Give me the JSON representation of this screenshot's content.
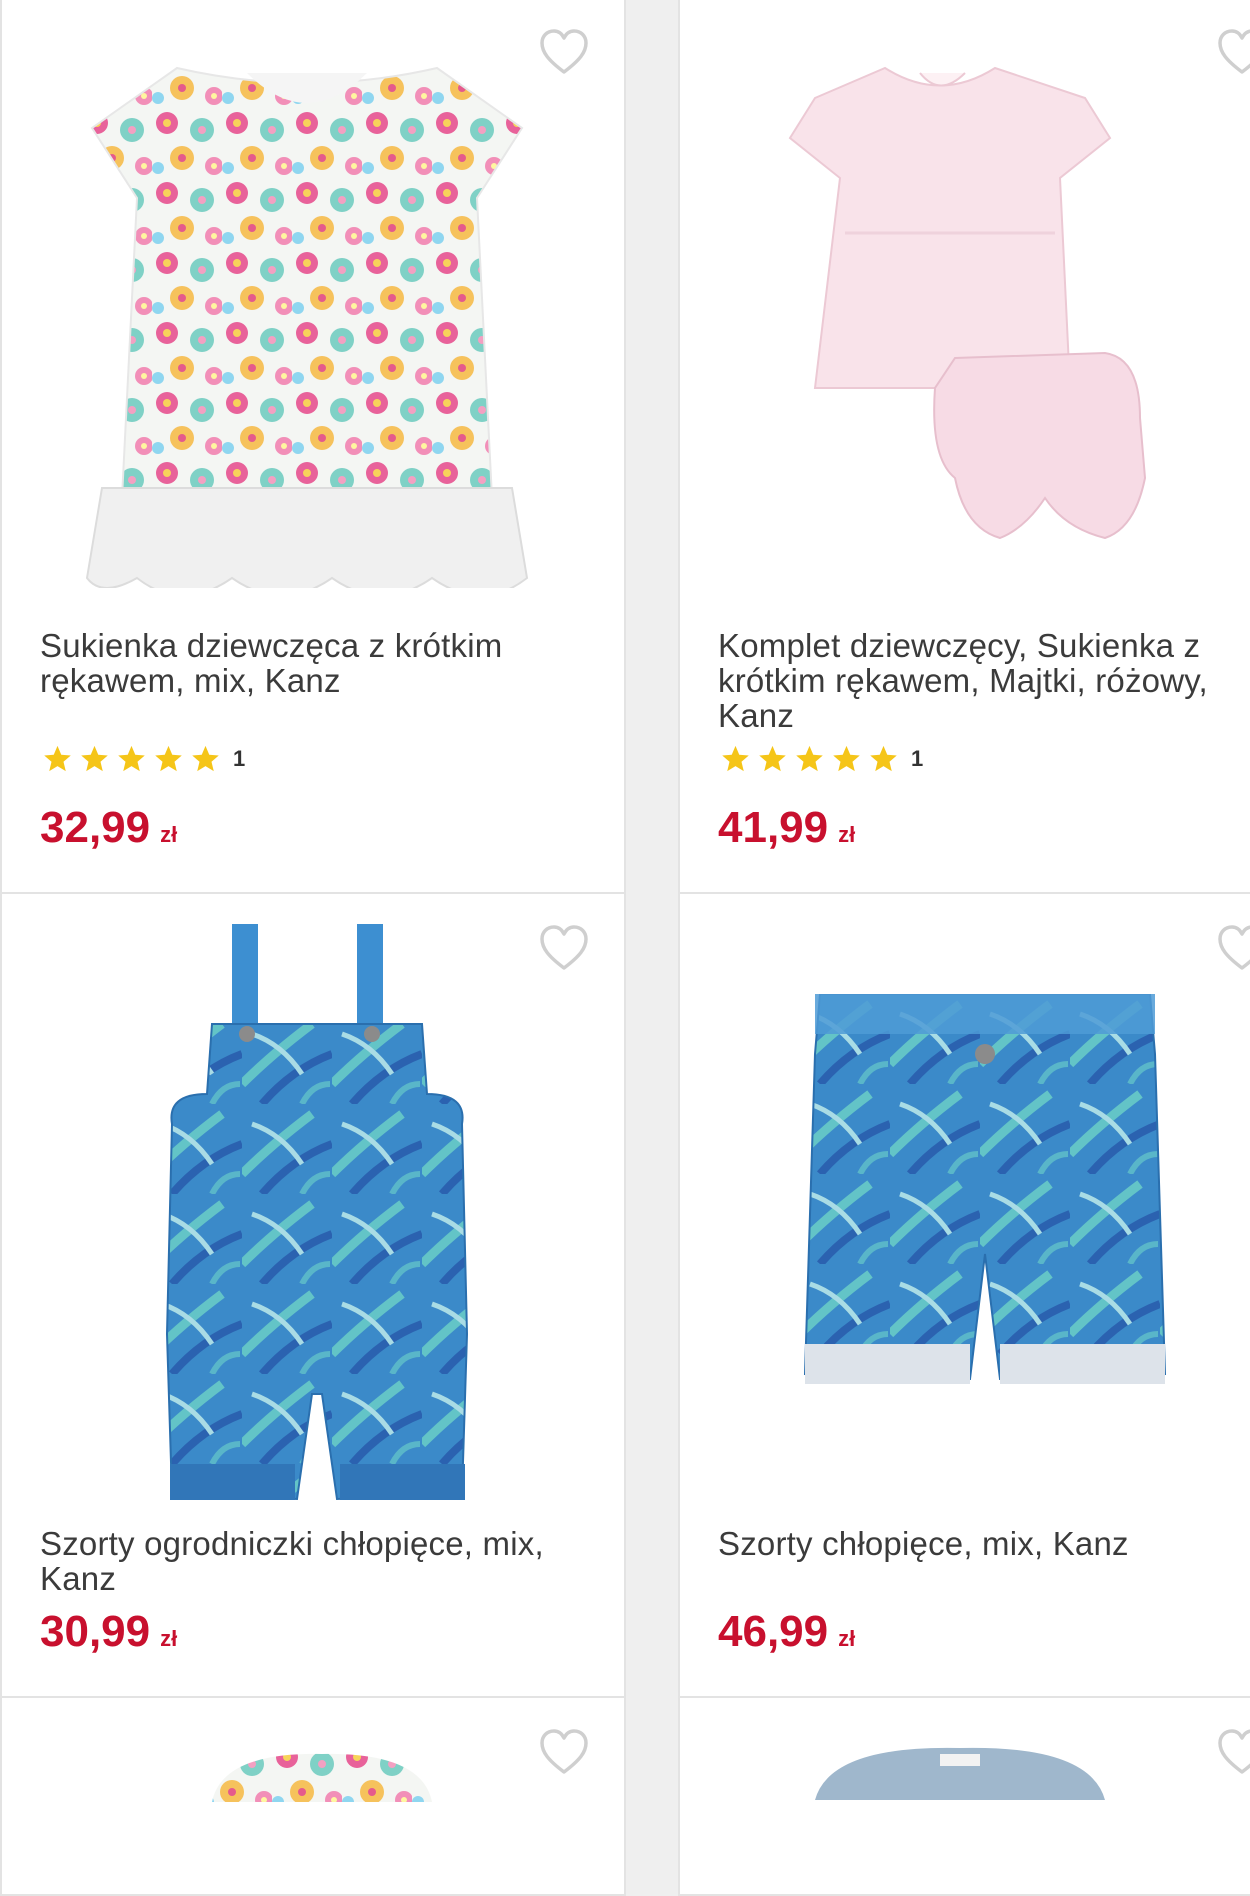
{
  "products": [
    {
      "title": "Sukienka dziewczęca z krótkim rękawem, mix, Kanz",
      "rating_count": "1",
      "rating_stars": 5,
      "price": "32,99",
      "currency": "zł",
      "image_icon": "floral-dress-image"
    },
    {
      "title": "Komplet dziewczęcy, Sukienka z krótkim rękawem, Majtki, różowy, Kanz",
      "rating_count": "1",
      "rating_stars": 5,
      "price": "41,99",
      "currency": "zł",
      "image_icon": "pink-dress-set-image"
    },
    {
      "title": "Szorty ogrodniczki chłopięce, mix, Kanz",
      "price": "30,99",
      "currency": "zł",
      "image_icon": "dungaree-shorts-image"
    },
    {
      "title": "Szorty chłopięce, mix, Kanz",
      "price": "46,99",
      "currency": "zł",
      "image_icon": "boys-shorts-image"
    }
  ],
  "colors": {
    "price": "#c8102e",
    "star": "#f5c518",
    "heart": "#cfcfcf"
  },
  "icons": {
    "favorite": "heart-outline-icon",
    "rating": "star-icon"
  }
}
